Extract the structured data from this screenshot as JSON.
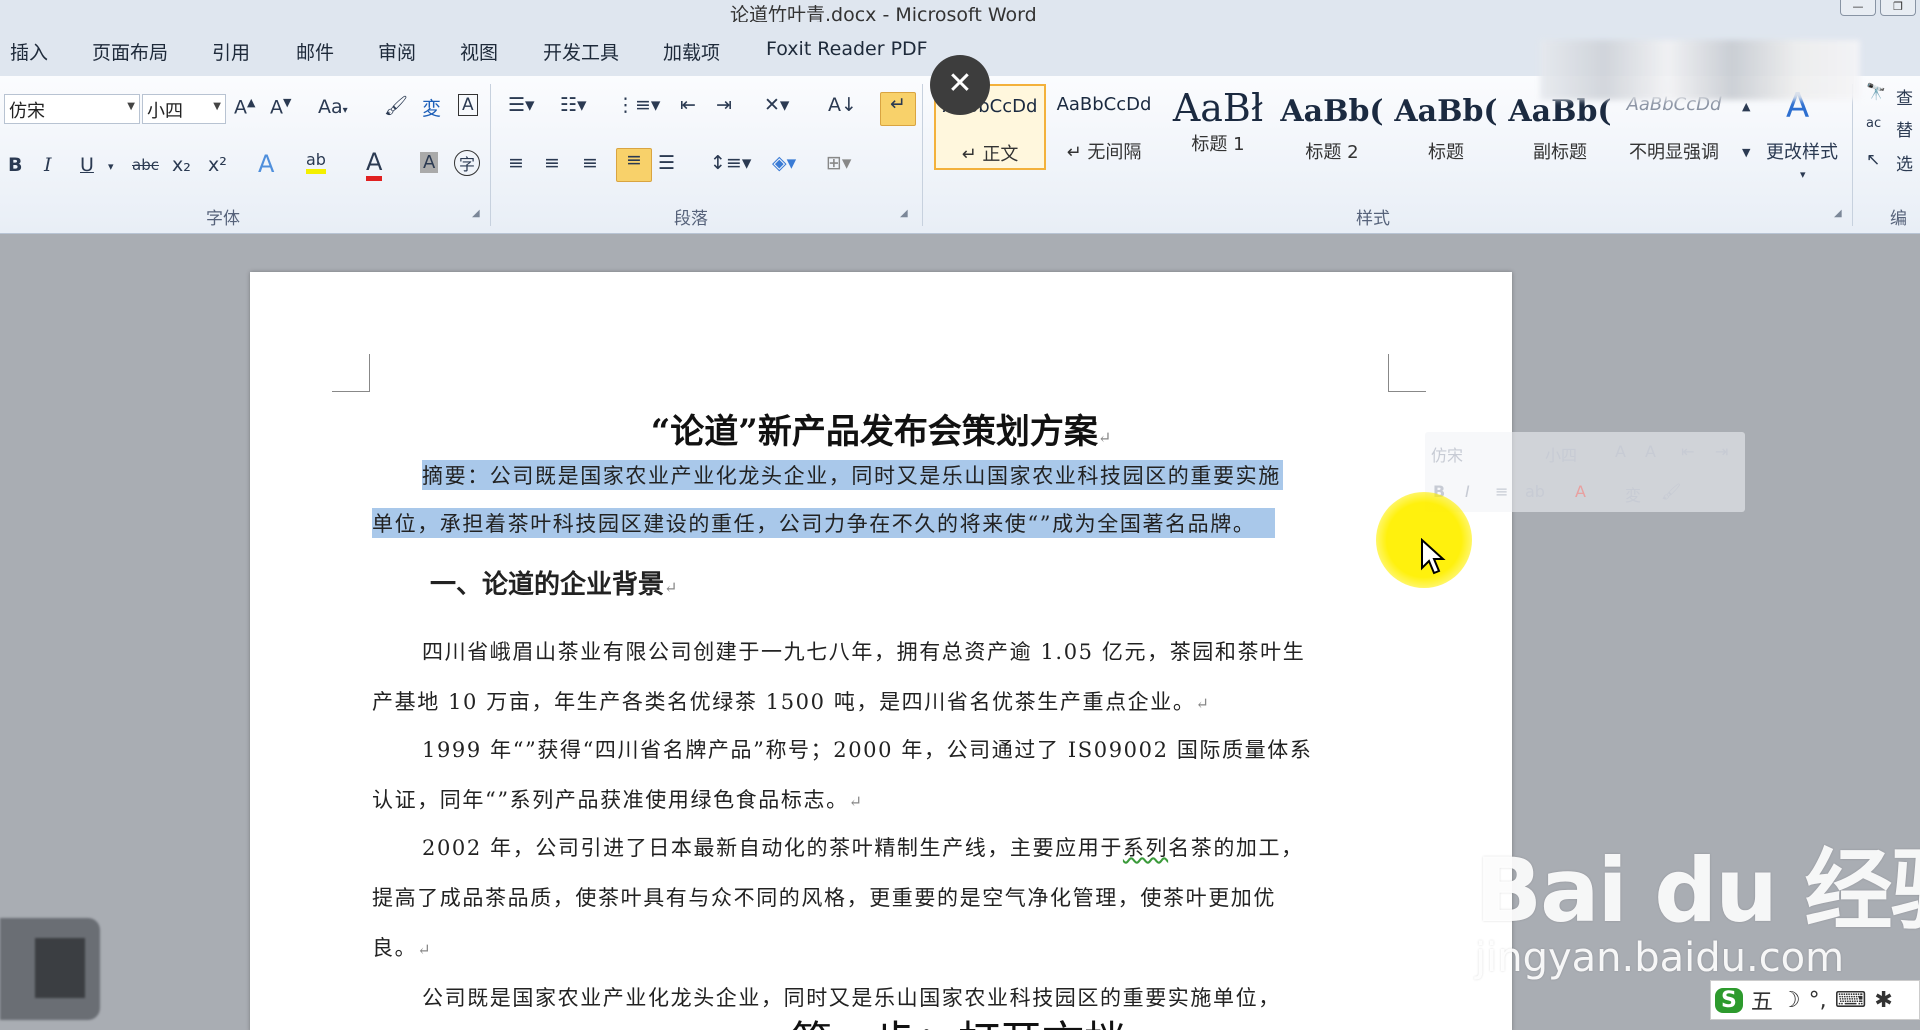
{
  "window": {
    "title": "论道竹叶青.docx - Microsoft Word"
  },
  "tabs": [
    "插入",
    "页面布局",
    "引用",
    "邮件",
    "审阅",
    "视图",
    "开发工具",
    "加载项",
    "Foxit Reader PDF"
  ],
  "font_group": {
    "label": "字体",
    "font_name": "仿宋",
    "font_size": "小四",
    "buttons": [
      "B",
      "I",
      "U",
      "abc",
      "x₂",
      "x²"
    ]
  },
  "paragraph_group": {
    "label": "段落"
  },
  "styles_group": {
    "label": "样式",
    "items": [
      {
        "preview": "AaBbCcDd",
        "label": "↵ 正文"
      },
      {
        "preview": "AaBbCcDd",
        "label": "↵ 无间隔"
      },
      {
        "preview": "AaBł",
        "label": "标题 1"
      },
      {
        "preview": "AaBb(",
        "label": "标题 2"
      },
      {
        "preview": "AaBb(",
        "label": "标题"
      },
      {
        "preview": "AaBb(",
        "label": "副标题"
      },
      {
        "preview": "AaBbCcDd",
        "label": "不明显强调"
      }
    ],
    "change_styles": "更改样式"
  },
  "edit_group": {
    "label": "编",
    "find": "查",
    "replace": "替",
    "select": "选"
  },
  "document": {
    "title": "“论道”新产品发布会策划方案",
    "abstract_line1": "摘要：公司既是国家农业产业化龙头企业，同时又是乐山国家农业科技园区的重要实施",
    "abstract_line2": "单位，承担着茶叶科技园区建设的重任，公司力争在不久的将来使“”成为全国著名品牌。",
    "heading1": "一、论道的企业背景",
    "p1_line1": "四川省峨眉山茶业有限公司创建于一九七八年，拥有总资产逾 1.05 亿元，茶园和茶叶生",
    "p1_line2": "产基地 10 万亩，年生产各类名优绿茶 1500 吨，是四川省名优茶生产重点企业。",
    "p2_line1": "1999 年“”获得“四川省名牌产品”称号；2000 年，公司通过了 IS09002 国际质量体系",
    "p2_line2": "认证，同年“”系列产品获准使用绿色食品标志。",
    "p3_line1a": "2002  年，公司引进了日本最新自动化的茶叶精制生产线，主要应用于",
    "p3_line1b": "系列",
    "p3_line1c": "名茶的加工，",
    "p3_line2": "提高了成品茶品质，使茶叶具有与众不同的风格，更重要的是空气净化管理，使茶叶更加优",
    "p3_line3": "良。",
    "p4_line1": "公司既是国家农业产业化龙头企业，同时又是乐山国家农业科技园区的重要实施单位，"
  },
  "minibar": {
    "font": "仿宋",
    "size": "小四"
  },
  "watermark": {
    "brand": "Bai du 经验",
    "url": "jingyan.baidu.com"
  },
  "ime": {
    "mode": "五"
  },
  "caption": "第一步：打开文档"
}
